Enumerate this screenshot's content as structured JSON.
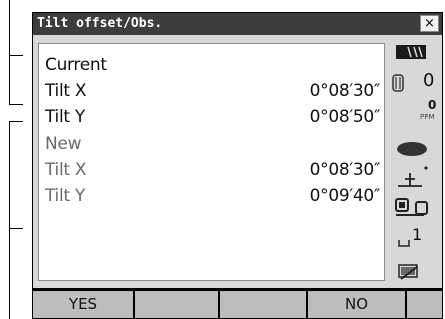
{
  "window": {
    "title": "Tilt offset/Obs.",
    "close_label": "×"
  },
  "current": {
    "heading": "Current",
    "rows": [
      {
        "label": "Tilt X",
        "value": "0°08′30″"
      },
      {
        "label": "Tilt Y",
        "value": "0°08′50″"
      }
    ]
  },
  "new": {
    "heading": "New",
    "rows": [
      {
        "label": "Tilt X",
        "value": "0°08′30″"
      },
      {
        "label": "Tilt Y",
        "value": "0°09′40″"
      }
    ]
  },
  "status": {
    "battery_icon": "battery-icon",
    "prism_icon": "prism-icon",
    "prism_const": "0",
    "ppm_value": "0",
    "ppm_label": "PPM",
    "laser_icon": "laser-icon",
    "tilt_icon": "tilt-icon",
    "comm_icon": "communication-icon",
    "mode_value": "1",
    "input_icon": "input-mode-icon"
  },
  "softkeys": [
    "YES",
    "",
    "",
    "NO",
    ""
  ]
}
